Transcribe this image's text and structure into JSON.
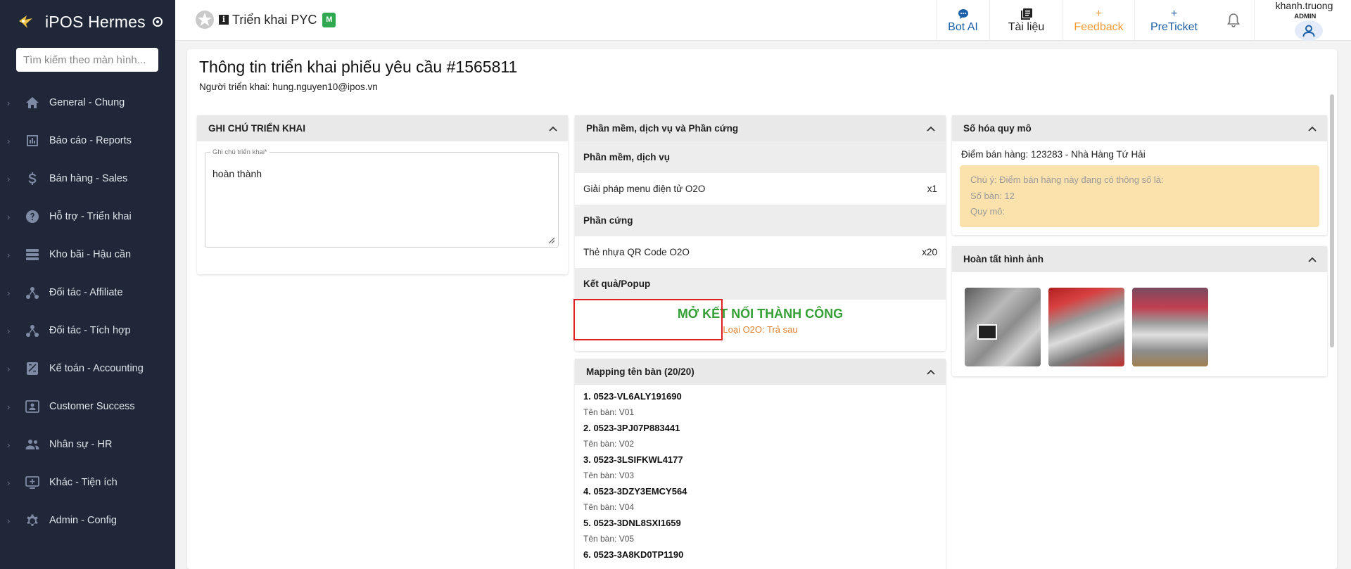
{
  "sidebar": {
    "brand": "iPOS Hermes",
    "search_placeholder": "Tìm kiếm theo màn hình...",
    "items": [
      {
        "label": "General - Chung",
        "icon": "home-icon"
      },
      {
        "label": "Báo cáo - Reports",
        "icon": "report-icon"
      },
      {
        "label": "Bán hàng - Sales",
        "icon": "dollar-icon"
      },
      {
        "label": "Hỗ trợ - Triển khai",
        "icon": "help-icon"
      },
      {
        "label": "Kho bãi - Hậu cần",
        "icon": "storage-icon"
      },
      {
        "label": "Đối tác - Affiliate",
        "icon": "hub-icon"
      },
      {
        "label": "Đối tác - Tích hợp",
        "icon": "hub-icon"
      },
      {
        "label": "Kế toán - Accounting",
        "icon": "calculator-icon"
      },
      {
        "label": "Customer Success",
        "icon": "contact-card-icon"
      },
      {
        "label": "Nhân sự - HR",
        "icon": "people-icon"
      },
      {
        "label": "Khác - Tiện ích",
        "icon": "add-screen-icon"
      },
      {
        "label": "Admin - Config",
        "icon": "gear-icon"
      }
    ]
  },
  "header": {
    "title": "Triển khai PYC",
    "badge": "M",
    "buttons": {
      "bot_ai": "Bot AI",
      "docs": "Tài liệu",
      "feedback": "Feedback",
      "preticket": "PreTicket"
    },
    "user_name": "khanh.truong",
    "user_role": "ADMIN"
  },
  "page": {
    "title": "Thông tin triển khai phiếu yêu cầu #1565811",
    "subtitle": "Người triển khai: hung.nguyen10@ipos.vn"
  },
  "notes_card": {
    "title": "GHI CHÚ TRIỂN KHAI",
    "field_label": "Ghi chú triển khai*",
    "field_value": "hoàn thành"
  },
  "software_card": {
    "title": "Phần mềm, dịch vụ và Phần cứng",
    "software_header": "Phần mềm, dịch vụ",
    "software_item": {
      "name": "Giải pháp menu điện tử O2O",
      "qty": "x1"
    },
    "hardware_header": "Phần cứng",
    "hardware_item": {
      "name": "Thẻ nhựa QR Code O2O",
      "qty": "x20"
    },
    "result_header": "Kết quả/Popup",
    "result_main": "MỞ KẾT NỐI THÀNH CÔNG",
    "result_sub": "Loại O2O: Trả sau"
  },
  "mapping_card": {
    "title": "Mapping tên bàn (20/20)",
    "items": [
      {
        "code": "1. 0523-VL6ALY191690",
        "name": "Tên bàn: V01"
      },
      {
        "code": "2. 0523-3PJ07P883441",
        "name": "Tên bàn: V02"
      },
      {
        "code": "3. 0523-3LSIFKWL4177",
        "name": "Tên bàn: V03"
      },
      {
        "code": "4. 0523-3DZY3EMCY564",
        "name": "Tên bàn: V04"
      },
      {
        "code": "5. 0523-3DNL8SXI1659",
        "name": "Tên bàn: V05"
      },
      {
        "code": "6. 0523-3A8KD0TP1190",
        "name": ""
      }
    ]
  },
  "digitize_card": {
    "title": "Số hóa quy mô",
    "store": "Điểm bán hàng: 123283 - Nhà Hàng Tứ Hải",
    "notice_line1": "Chú ý: Điểm bán hàng này đang có thông số là:",
    "notice_line2": "Số bàn: 12",
    "notice_line3": "Quy mô:"
  },
  "photos_card": {
    "title": "Hoàn tất hình ảnh"
  },
  "colors": {
    "sidebar_bg": "#1f2738",
    "accent_blue": "#1b5fa8",
    "feedback_orange": "#f29b38",
    "success_green": "#34a035",
    "highlight_red": "#e02020",
    "notice_bg": "#fbe2ad"
  }
}
